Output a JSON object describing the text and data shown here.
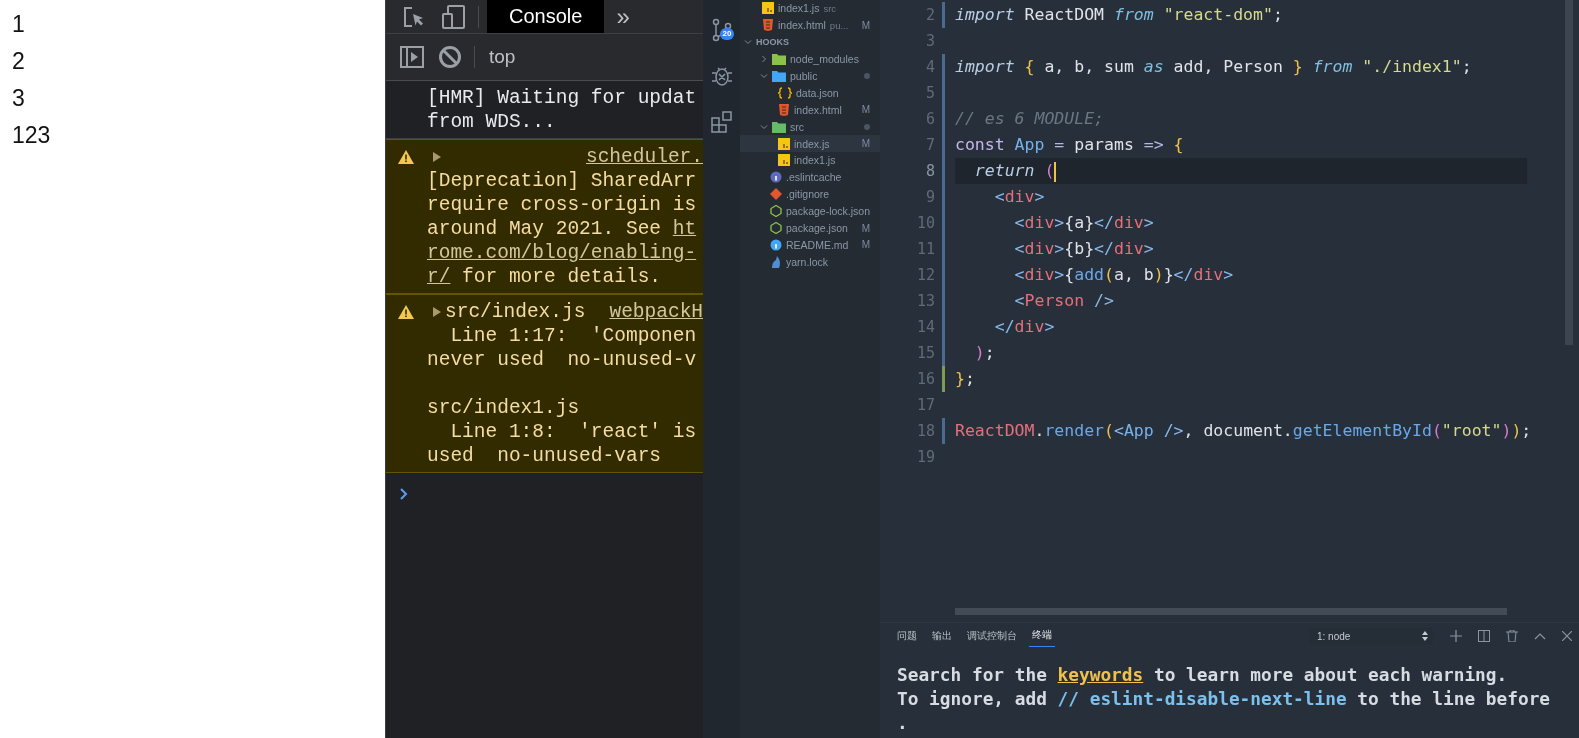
{
  "page_lines": [
    "1",
    "2",
    "3",
    "123"
  ],
  "devtools": {
    "tabs": [
      {
        "label": "Console",
        "selected": true
      }
    ],
    "more_tabs": "»",
    "context": "top",
    "messages": [
      {
        "kind": "log",
        "paragraphs": [
          [
            [
              {
                "text": "[HMR] Waiting for updat",
                "link": false
              }
            ],
            [
              {
                "text": "from WDS...",
                "link": false
              }
            ]
          ]
        ]
      },
      {
        "kind": "warning",
        "source": "scheduler.",
        "paragraphs": [
          [
            [
              {
                "text": "[Deprecation] SharedArr",
                "link": false
              }
            ],
            [
              {
                "text": "require cross-origin is",
                "link": false
              }
            ],
            [
              {
                "text": "around May 2021. See ",
                "link": false
              },
              {
                "text": "ht",
                "link": true
              }
            ],
            [
              {
                "text": "rome.com/blog/enabling-",
                "link": true
              }
            ],
            [
              {
                "text": "r/",
                "link": true
              },
              {
                "text": " for more details.",
                "link": false
              }
            ]
          ]
        ]
      },
      {
        "kind": "warning",
        "header": "src/index.js",
        "source": "webpackH",
        "paragraphs": [
          [
            [
              {
                "text": "  Line 1:17:  'Componen",
                "link": false
              }
            ],
            [
              {
                "text": "never used  no-unused-v",
                "link": false
              }
            ]
          ],
          [
            [
              {
                "text": "src/index1.js",
                "link": false
              }
            ],
            [
              {
                "text": "  Line 1:8:  'react' is",
                "link": false
              }
            ],
            [
              {
                "text": "used  no-unused-vars",
                "link": false
              }
            ]
          ]
        ]
      }
    ]
  },
  "activity_bar": {
    "source_control_badge": "20"
  },
  "explorer": {
    "open_editors": [
      {
        "name": "index1.js",
        "description": "src",
        "kind": "js"
      },
      {
        "name": "index.html",
        "description": "pu...",
        "kind": "html",
        "status": "M"
      }
    ],
    "section": "HOOKS",
    "expanded": true,
    "tree": [
      {
        "name": "node_modules",
        "kind": "folder-node",
        "expanded": false,
        "changes": false,
        "selected": false
      },
      {
        "name": "public",
        "kind": "folder-public",
        "expanded": true,
        "changes": true,
        "selected": false,
        "children": [
          {
            "name": "data.json",
            "kind": "json",
            "selected": false
          },
          {
            "name": "index.html",
            "kind": "html",
            "status": "M",
            "selected": false
          }
        ]
      },
      {
        "name": "src",
        "kind": "folder-src",
        "expanded": true,
        "changes": true,
        "selected": false,
        "children": [
          {
            "name": "index.js",
            "kind": "js",
            "status": "M",
            "selected": true
          },
          {
            "name": "index1.js",
            "kind": "js",
            "selected": false
          }
        ]
      },
      {
        "name": ".eslintcache",
        "kind": "eslint",
        "selected": false
      },
      {
        "name": ".gitignore",
        "kind": "git",
        "selected": false
      },
      {
        "name": "package-lock.json",
        "kind": "npm",
        "selected": false
      },
      {
        "name": "package.json",
        "kind": "npm",
        "status": "M",
        "selected": false
      },
      {
        "name": "README.md",
        "kind": "info",
        "status": "M",
        "selected": false
      },
      {
        "name": "yarn.lock",
        "kind": "yarn",
        "selected": false
      }
    ]
  },
  "editor": {
    "lines": [
      {
        "number": "2",
        "modified": true,
        "added": false,
        "current": false,
        "tokens": [
          {
            "kind": "kw",
            "text": "import"
          },
          {
            "kind": "plain",
            "text": " ReactDOM "
          },
          {
            "kind": "kw2",
            "text": "from"
          },
          {
            "kind": "str",
            "text": " \"react-dom\""
          },
          {
            "kind": "plain",
            "text": ";"
          }
        ]
      },
      {
        "number": "3",
        "modified": false,
        "added": false,
        "current": false
      },
      {
        "number": "4",
        "modified": true,
        "added": false,
        "current": false,
        "tokens": [
          {
            "kind": "kw",
            "text": "import"
          },
          {
            "kind": "brace",
            "text": " {"
          },
          {
            "kind": "plain",
            "text": " a, b, sum "
          },
          {
            "kind": "kw2",
            "text": "as"
          },
          {
            "kind": "plain",
            "text": " add, Person "
          },
          {
            "kind": "brace",
            "text": "}"
          },
          {
            "kind": "kw2",
            "text": " from"
          },
          {
            "kind": "str",
            "text": " \"./index1\""
          },
          {
            "kind": "plain",
            "text": ";"
          }
        ]
      },
      {
        "number": "5",
        "modified": true,
        "added": false,
        "current": false
      },
      {
        "number": "6",
        "modified": true,
        "added": false,
        "current": false,
        "tokens": [
          {
            "kind": "comment",
            "text": "// es 6 MODULE;"
          }
        ]
      },
      {
        "number": "7",
        "modified": true,
        "added": false,
        "current": false,
        "tokens": [
          {
            "kind": "storage",
            "text": "const"
          },
          {
            "kind": "cls",
            "text": " App"
          },
          {
            "kind": "op",
            "text": " ="
          },
          {
            "kind": "plain",
            "text": " params "
          },
          {
            "kind": "op",
            "text": "=>"
          },
          {
            "kind": "brace",
            "text": " {"
          }
        ]
      },
      {
        "number": "8",
        "modified": true,
        "added": false,
        "current": true,
        "tokens": [
          {
            "kind": "kw",
            "text": "  return"
          },
          {
            "kind": "paren",
            "text": " ("
          }
        ]
      },
      {
        "number": "9",
        "modified": true,
        "added": false,
        "current": false,
        "tokens": [
          {
            "kind": "angle",
            "text": "    <"
          },
          {
            "kind": "tag",
            "text": "div"
          },
          {
            "kind": "angle",
            "text": ">"
          }
        ]
      },
      {
        "number": "10",
        "modified": true,
        "added": false,
        "current": false,
        "tokens": [
          {
            "kind": "angle",
            "text": "      <"
          },
          {
            "kind": "tag",
            "text": "div"
          },
          {
            "kind": "angle",
            "text": ">"
          },
          {
            "kind": "plain",
            "text": "{a}"
          },
          {
            "kind": "angle",
            "text": "</"
          },
          {
            "kind": "tag",
            "text": "div"
          },
          {
            "kind": "angle",
            "text": ">"
          }
        ]
      },
      {
        "number": "11",
        "modified": true,
        "added": false,
        "current": false,
        "tokens": [
          {
            "kind": "angle",
            "text": "      <"
          },
          {
            "kind": "tag",
            "text": "div"
          },
          {
            "kind": "angle",
            "text": ">"
          },
          {
            "kind": "plain",
            "text": "{b}"
          },
          {
            "kind": "angle",
            "text": "</"
          },
          {
            "kind": "tag",
            "text": "div"
          },
          {
            "kind": "angle",
            "text": ">"
          }
        ]
      },
      {
        "number": "12",
        "modified": true,
        "added": false,
        "current": false,
        "tokens": [
          {
            "kind": "angle",
            "text": "      <"
          },
          {
            "kind": "tag",
            "text": "div"
          },
          {
            "kind": "angle",
            "text": ">"
          },
          {
            "kind": "plain",
            "text": "{"
          },
          {
            "kind": "func",
            "text": "add"
          },
          {
            "kind": "brace",
            "text": "("
          },
          {
            "kind": "plain",
            "text": "a, b"
          },
          {
            "kind": "brace",
            "text": ")"
          },
          {
            "kind": "plain",
            "text": "}"
          },
          {
            "kind": "angle",
            "text": "</"
          },
          {
            "kind": "tag",
            "text": "div"
          },
          {
            "kind": "angle",
            "text": ">"
          }
        ]
      },
      {
        "number": "13",
        "modified": true,
        "added": false,
        "current": false,
        "tokens": [
          {
            "kind": "angle",
            "text": "      <"
          },
          {
            "kind": "tag",
            "text": "Person"
          },
          {
            "kind": "angle",
            "text": " />"
          }
        ]
      },
      {
        "number": "14",
        "modified": true,
        "added": false,
        "current": false,
        "tokens": [
          {
            "kind": "angle",
            "text": "    </"
          },
          {
            "kind": "tag",
            "text": "div"
          },
          {
            "kind": "angle",
            "text": ">"
          }
        ]
      },
      {
        "number": "15",
        "modified": true,
        "added": false,
        "current": false,
        "tokens": [
          {
            "kind": "paren",
            "text": "  )"
          },
          {
            "kind": "plain",
            "text": ";"
          }
        ]
      },
      {
        "number": "16",
        "modified": false,
        "added": true,
        "current": false,
        "tokens": [
          {
            "kind": "brace",
            "text": "}"
          },
          {
            "kind": "plain",
            "text": ";"
          }
        ]
      },
      {
        "number": "17",
        "modified": false,
        "added": false,
        "current": false
      },
      {
        "number": "18",
        "modified": true,
        "added": false,
        "current": false,
        "tokens": [
          {
            "kind": "obj",
            "text": "ReactDOM"
          },
          {
            "kind": "plain",
            "text": "."
          },
          {
            "kind": "func",
            "text": "render"
          },
          {
            "kind": "brace",
            "text": "("
          },
          {
            "kind": "angle",
            "text": "<"
          },
          {
            "kind": "cls",
            "text": "App"
          },
          {
            "kind": "angle",
            "text": " />"
          },
          {
            "kind": "plain",
            "text": ", document."
          },
          {
            "kind": "func",
            "text": "getElementById"
          },
          {
            "kind": "paren",
            "text": "("
          },
          {
            "kind": "str",
            "text": "\"root\""
          },
          {
            "kind": "paren",
            "text": ")"
          },
          {
            "kind": "brace",
            "text": ")"
          },
          {
            "kind": "plain",
            "text": ";"
          }
        ]
      },
      {
        "number": "19",
        "modified": false,
        "added": false,
        "current": false
      }
    ]
  },
  "panel": {
    "tabs": [
      {
        "label": "问题",
        "selected": false
      },
      {
        "label": "输出",
        "selected": false
      },
      {
        "label": "调试控制台",
        "selected": false
      },
      {
        "label": "终端",
        "selected": true
      }
    ],
    "terminal_select": "1: node",
    "terminal_lines": [
      [
        {
          "kind": "plain",
          "text": "Search for the "
        },
        {
          "kind": "link",
          "text": "keywords"
        },
        {
          "kind": "plain",
          "text": " to learn more about each warning."
        }
      ],
      [
        {
          "kind": "plain",
          "text": "To ignore, add "
        },
        {
          "kind": "code",
          "text": "// eslint-disable-next-line"
        },
        {
          "kind": "plain",
          "text": " to the line before"
        }
      ],
      [
        {
          "kind": "plain",
          "text": "."
        }
      ]
    ]
  }
}
